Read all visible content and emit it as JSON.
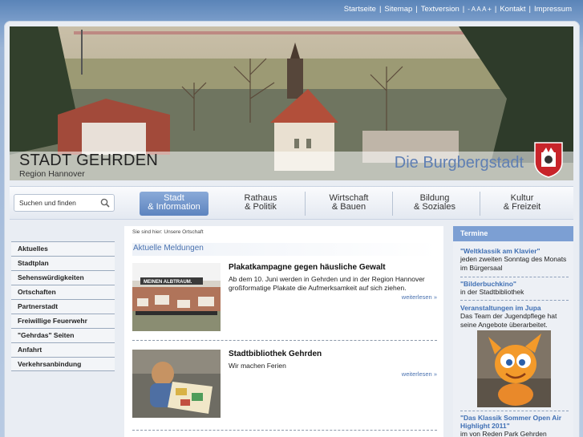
{
  "topbar": {
    "links": [
      "Startseite",
      "Sitemap",
      "Textversion",
      "- A A A +",
      "Kontakt",
      "Impressum"
    ]
  },
  "header": {
    "title": "STADT GEHRDEN",
    "region": "Region Hannover",
    "slogan": "Die Burgbergstadt",
    "crest_icon": "coat-of-arms-icon"
  },
  "search": {
    "placeholder": "Suchen und finden"
  },
  "nav": {
    "items": [
      {
        "line1": "Stadt",
        "line2": "& Information"
      },
      {
        "line1": "Rathaus",
        "line2": "& Politik"
      },
      {
        "line1": "Wirtschaft",
        "line2": "& Bauen"
      },
      {
        "line1": "Bildung",
        "line2": "& Soziales"
      },
      {
        "line1": "Kultur",
        "line2": "& Freizeit"
      }
    ]
  },
  "leftmenu": {
    "items": [
      "Aktuelles",
      "Stadtplan",
      "Sehenswürdigkeiten",
      "Ortschaften",
      "Partnerstadt",
      "Freiwillige Feuerwehr",
      "\"Gehrdas\" Seiten",
      "Anfahrt",
      "Verkehrsanbindung"
    ]
  },
  "main": {
    "breadcrumb": "Sie sind hier: Unsere Ortschaft",
    "section_title": "Aktuelle Meldungen",
    "news": [
      {
        "title": "Plakatkampagne gegen häusliche Gewalt",
        "text": "Ab dem 10. Juni werden in Gehrden und in der Region Hannover großformatige Plakate die Aufmerksamkeit auf sich ziehen.",
        "more": "weiterlesen »",
        "poster_text": "MEINEN ALBTRAUM."
      },
      {
        "title": "Stadtbibliothek Gehrden",
        "text": "Wir machen Ferien",
        "more": "weiterlesen »"
      }
    ]
  },
  "termine": {
    "heading": "Termine",
    "items": [
      {
        "title": "\"Weltklassik am Klavier\"",
        "text": "jeden zweiten Sonntag des Monats im Bürgersaal"
      },
      {
        "title": "\"Bilderbuchkino\"",
        "text": "in der Stadtbibliothek"
      },
      {
        "title": "Veranstaltungen im Jupa",
        "text": "Das Team der Jugendpflege hat seine Angebote überarbeitet."
      },
      {
        "title": "\"Das Klassik Sommer Open Air Highlight 2011\"",
        "text": "im von Reden Park Gehrden"
      }
    ]
  },
  "colors": {
    "accent": "#5d84bf",
    "link": "#4a72b0",
    "header_slogan": "#5f7fb3"
  }
}
